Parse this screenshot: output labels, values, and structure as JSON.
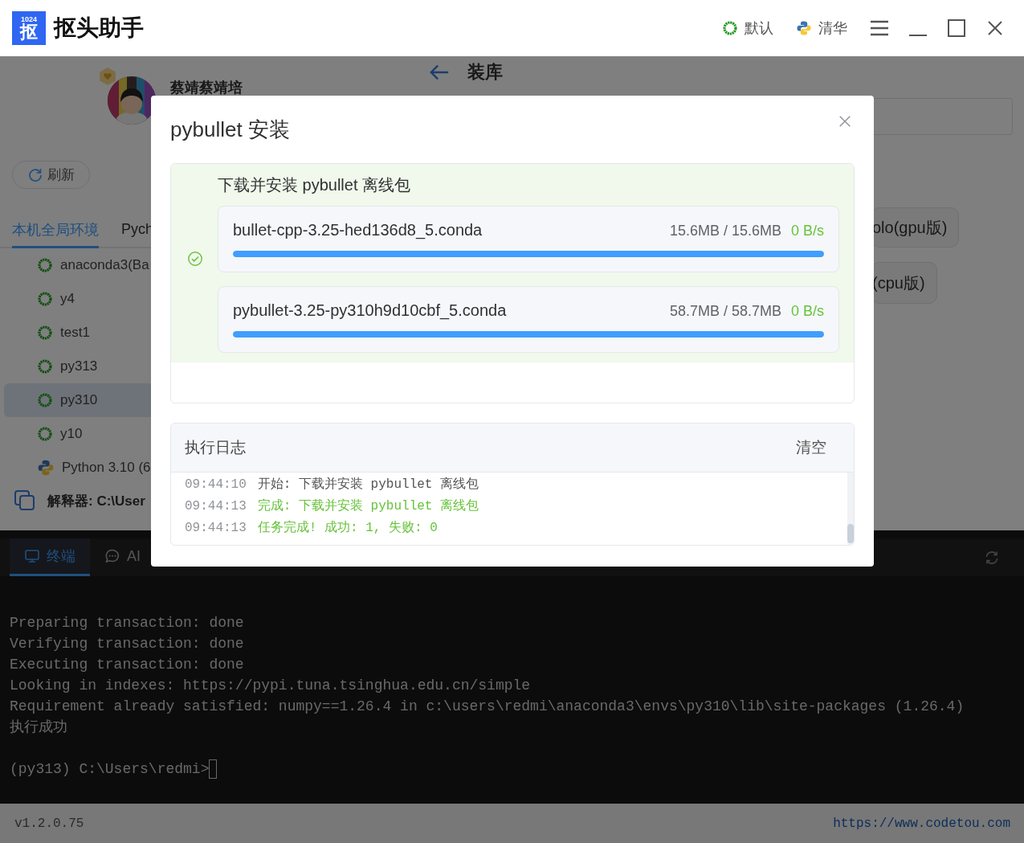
{
  "title_bar": {
    "logo": {
      "number": "1024",
      "glyph": "抠"
    },
    "app_name": "抠头助手",
    "mirrors": [
      {
        "kind": "conda",
        "label": "默认"
      },
      {
        "kind": "python",
        "label": "清华"
      }
    ]
  },
  "page": {
    "title": "装库"
  },
  "profile": {
    "name": "蔡靖蔡靖培"
  },
  "refresh_button": "刷新",
  "env_tabs": [
    {
      "label": "本机全局环境",
      "selected": true
    },
    {
      "label": "Pych",
      "selected": false
    }
  ],
  "environments": [
    {
      "kind": "conda",
      "name": "anaconda3(Ba",
      "selected": false
    },
    {
      "kind": "conda",
      "name": "y4",
      "selected": false
    },
    {
      "kind": "conda",
      "name": "test1",
      "selected": false
    },
    {
      "kind": "conda",
      "name": "py313",
      "selected": false
    },
    {
      "kind": "conda",
      "name": "py310",
      "selected": true
    },
    {
      "kind": "conda",
      "name": "y10",
      "selected": false
    },
    {
      "kind": "python",
      "name": "Python 3.10 (6",
      "selected": false
    }
  ],
  "interpreter": "解释器: C:\\User",
  "package_chips": [
    "olo(gpu版)",
    "(cpu版)"
  ],
  "terminal": {
    "tabs": [
      {
        "kind": "terminal",
        "label": "终端",
        "selected": true
      },
      {
        "kind": "chat",
        "label": "AI",
        "selected": false
      }
    ],
    "lines": [
      "Preparing transaction: done",
      "Verifying transaction: done",
      "Executing transaction: done",
      "Looking in indexes: https://pypi.tuna.tsinghua.edu.cn/simple",
      "Requirement already satisfied: numpy==1.26.4 in c:\\users\\redmi\\anaconda3\\envs\\py310\\lib\\site-packages (1.26.4)",
      "执行成功"
    ],
    "prompt": "(py313) C:\\Users\\redmi>"
  },
  "status_bar": {
    "version": "v1.2.0.75",
    "link": "https://www.codetou.com"
  },
  "dialog": {
    "title": "pybullet 安装",
    "task": {
      "title": "下载并安装 pybullet 离线包",
      "done": true,
      "files": [
        {
          "name": "bullet-cpp-3.25-hed136d8_5.conda",
          "size": "15.6MB / 15.6MB",
          "speed": "0 B/s",
          "level": 1
        },
        {
          "name": "pybullet-3.25-py310h9d10cbf_5.conda",
          "size": "58.7MB / 58.7MB",
          "speed": "0 B/s",
          "level": 1
        }
      ]
    },
    "log": {
      "title": "执行日志",
      "clear": "清空",
      "lines": [
        {
          "time": "09:44:10",
          "message": "开始: 下载并安装 pybullet 离线包",
          "kind": "info"
        },
        {
          "time": "09:44:13",
          "message": "完成: 下载并安装 pybullet 离线包",
          "kind": "success"
        },
        {
          "time": "09:44:13",
          "message": "任务完成! 成功: 1, 失败: 0",
          "kind": "success"
        }
      ]
    }
  }
}
